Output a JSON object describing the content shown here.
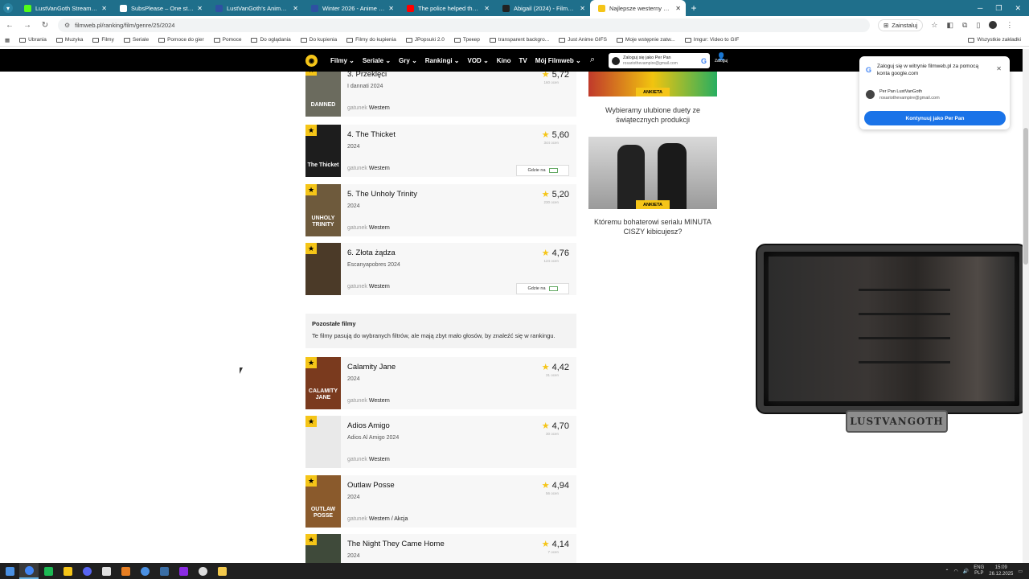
{
  "browser": {
    "tabs": [
      {
        "title": "LustVanGoth Stream - Watch L",
        "color": "#53fc18",
        "active": false
      },
      {
        "title": "SubsPlease – One stop shop fo",
        "color": "#ffffff",
        "active": false
      },
      {
        "title": "LustVanGoth's Anime List - My",
        "color": "#2e51a2",
        "active": false
      },
      {
        "title": "Winter 2026 - Anime - MyAnim",
        "color": "#2e51a2",
        "active": false
      },
      {
        "title": "The police helped the girl get a",
        "color": "#ff0000",
        "active": false
      },
      {
        "title": "Abigail (2024) - Filman.cc - Film",
        "color": "#222222",
        "active": false
      },
      {
        "title": "Najlepsze westerny z 2024 roku",
        "color": "#f5c518",
        "active": true
      }
    ],
    "new_tab": "+",
    "url": "filmweb.pl/ranking/film/genre/25/2024",
    "install_label": "Zainstaluj",
    "bookmarks": [
      "Ubrania",
      "Muzyka",
      "Filmy",
      "Seriale",
      "Pomoce do gier",
      "Pomoce",
      "Do oglądania",
      "Do kupienia",
      "Filmy do kupienia",
      "JPopsuki 2.0",
      "Трекер",
      "transparent backgro...",
      "Just Anime GIFS",
      "Moje wstępnie zatw...",
      "Imgur: Video to GIF"
    ],
    "bookmarks_all": "Wszystkie zakładki"
  },
  "site_nav": {
    "items": [
      "Filmy",
      "Seriale",
      "Gry",
      "Rankingi",
      "VOD",
      "Kino",
      "TV",
      "Mój Filmweb"
    ],
    "login_line1": "Zaloguj się jako Per Pan",
    "login_line2": "rosariothevampire@gmail.com",
    "user_label": "Zaloguj"
  },
  "ranking": [
    {
      "title": "3. Przeklęci",
      "year": "I dannati 2024",
      "genre_label": "gatunek",
      "genre": "Western",
      "rating": "5,72",
      "votes": "160 ocen",
      "where": false,
      "poster_text": "DAMNED",
      "poster_color": "#6b6b5e"
    },
    {
      "title": "4. The Thicket",
      "year": "2024",
      "genre_label": "gatunek",
      "genre": "Western",
      "rating": "5,60",
      "votes": "344 ocen",
      "where": true,
      "poster_text": "The Thicket",
      "poster_color": "#1d1d1d"
    },
    {
      "title": "5. The Unholy Trinity",
      "year": "2024",
      "genre_label": "gatunek",
      "genre": "Western",
      "rating": "5,20",
      "votes": "230 ocen",
      "where": false,
      "poster_text": "UNHOLY TRINITY",
      "poster_color": "#6e5a3c"
    },
    {
      "title": "6. Złota żądza",
      "year": "Escanyapobres 2024",
      "genre_label": "gatunek",
      "genre": "Western",
      "rating": "4,76",
      "votes": "124 ocen",
      "where": true,
      "poster_text": "",
      "poster_color": "#4b3a28"
    }
  ],
  "where_label": "Gdzie na",
  "others": {
    "heading": "Pozostałe filmy",
    "desc": "Te filmy pasują do wybranych filtrów, ale mają zbyt mało głosów, by znaleźć się w rankingu."
  },
  "other_films": [
    {
      "title": "Calamity Jane",
      "year": "2024",
      "genre_label": "gatunek",
      "genre": "Western",
      "rating": "4,42",
      "votes": "31 ocen",
      "poster_text": "CALAMITY JANE",
      "poster_color": "#7a3a1e"
    },
    {
      "title": "Adios Amigo",
      "year": "Adios Al Amigo 2024",
      "genre_label": "gatunek",
      "genre": "Western",
      "rating": "4,70",
      "votes": "30 ocen",
      "poster_text": "",
      "poster_color": "#e9e9e9"
    },
    {
      "title": "Outlaw Posse",
      "year": "2024",
      "genre_label": "gatunek",
      "genre": "Western / Akcja",
      "rating": "4,94",
      "votes": "56 ocen",
      "poster_text": "OUTLAW POSSE",
      "poster_color": "#8a5a2c"
    },
    {
      "title": "The Night They Came Home",
      "year": "2024",
      "genre_label": "gatunek",
      "genre": "",
      "rating": "4,14",
      "votes": "7 ocen",
      "poster_text": "",
      "poster_color": "#3f4a3a"
    }
  ],
  "sidebar": {
    "promo1_tag": "ANKIETA",
    "promo1_caption": "Wybieramy ulubione duety ze świątecznych produkcji",
    "promo2_tag": "ANKIETA",
    "promo2_caption": "Któremu bohaterowi serialu MINUTA CISZY kibicujesz?"
  },
  "google_popup": {
    "text": "Zaloguj się w witrynie filmweb.pl za pomocą konta google.com",
    "name": "Per Pan LustVanGoth",
    "email": "rosariothevampire@gmail.com",
    "button": "Kontynuuj jako Per Pan"
  },
  "overlay": {
    "nameplate": "LUSTVANGOTH"
  },
  "taskbar": {
    "apps": [
      "#4285f4",
      "#1db954",
      "#f5c518",
      "#5865f2",
      "#e0e0e0",
      "#e67e22",
      "#4a90e2",
      "#3a6ea5",
      "#8a2be2",
      "#dddddd",
      "#f2c94c"
    ],
    "lang1": "ENG",
    "lang2": "PLP",
    "time": "15:09",
    "date": "26.12.2025"
  }
}
